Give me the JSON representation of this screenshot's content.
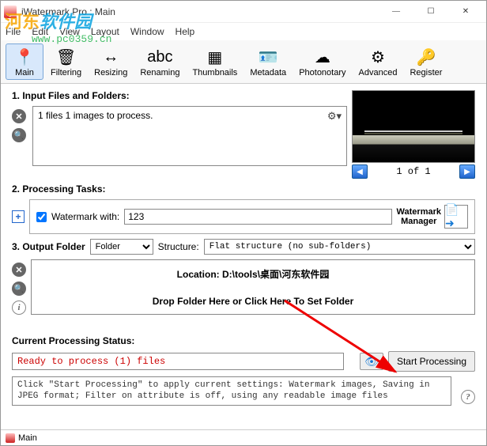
{
  "title": "iWatermark Pro : Main",
  "menu": [
    "File",
    "Edit",
    "View",
    "Layout",
    "Window",
    "Help"
  ],
  "toolbar": [
    {
      "label": "Main",
      "glyph": "📍",
      "active": true
    },
    {
      "label": "Filtering",
      "glyph": "🗑"
    },
    {
      "label": "Resizing",
      "glyph": "↔"
    },
    {
      "label": "Renaming",
      "glyph": "abc"
    },
    {
      "label": "Thumbnails",
      "glyph": "▦"
    },
    {
      "label": "Metadata",
      "glyph": "🪪"
    },
    {
      "label": "Photonotary",
      "glyph": "☁"
    },
    {
      "label": "Advanced",
      "glyph": "⚙"
    },
    {
      "label": "Register",
      "glyph": "🔑"
    }
  ],
  "section1": {
    "title": "1. Input Files and Folders:",
    "line": "1 files 1 images to process."
  },
  "preview_pager": "1  of  1",
  "section2": {
    "title": "2. Processing Tasks:",
    "checkbox_label": "Watermark with:",
    "watermark_value": "123",
    "btn_label": "Watermark\nManager"
  },
  "section3": {
    "title": "3. Output Folder",
    "folder_select": "Folder",
    "structure_label": "Structure:",
    "structure_value": "Flat structure (no sub-folders)",
    "location": "Location:  D:\\tools\\桌面\\河东软件园",
    "drop": "Drop Folder Here or Click Here To Set Folder"
  },
  "status": {
    "title": "Current Processing Status:",
    "text": "Ready to process (1) files",
    "hint": "Click \"Start Processing\" to apply current settings: Watermark images, Saving in JPEG format; Filter on attribute is off, using any readable image files",
    "start": "Start Processing"
  },
  "statusbar": "Main",
  "overlay": {
    "l1a": "河东",
    "l1b": "软件园",
    "l2": "www.pc0359.cn"
  }
}
